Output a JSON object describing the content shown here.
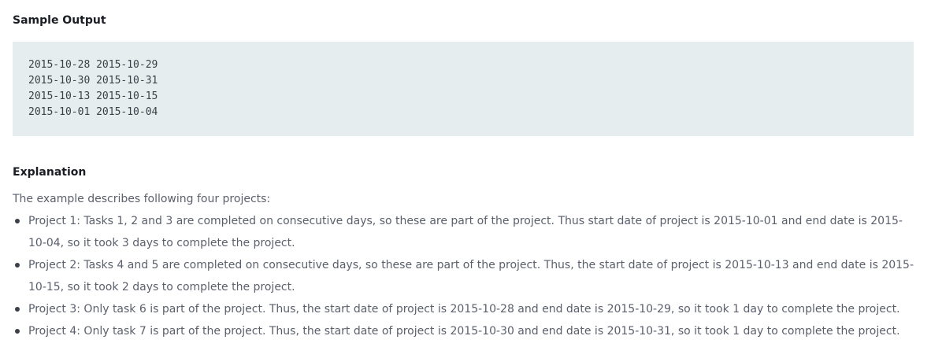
{
  "sample_output": {
    "heading": "Sample Output",
    "lines": [
      "2015-10-28 2015-10-29",
      "2015-10-30 2015-10-31",
      "2015-10-13 2015-10-15",
      "2015-10-01 2015-10-04"
    ]
  },
  "explanation": {
    "heading": "Explanation",
    "intro": "The example describes following four projects:",
    "items": [
      "Project 1: Tasks 1, 2 and 3 are completed on consecutive days, so these are part of the project. Thus start date of project is 2015-10-01 and end date is 2015-10-04, so it took 3 days to complete the project.",
      "Project 2: Tasks 4 and 5 are completed on consecutive days, so these are part of the project. Thus, the start date of project is 2015-10-13 and end date is 2015-10-15, so it took 2 days to complete the project.",
      "Project 3: Only task 6 is part of the project. Thus, the start date of project is 2015-10-28 and end date is 2015-10-29, so it took 1 day to complete the project.",
      "Project 4: Only task 7 is part of the project. Thus, the start date of project is 2015-10-30 and end date is 2015-10-31, so it took 1 day to complete the project."
    ]
  }
}
